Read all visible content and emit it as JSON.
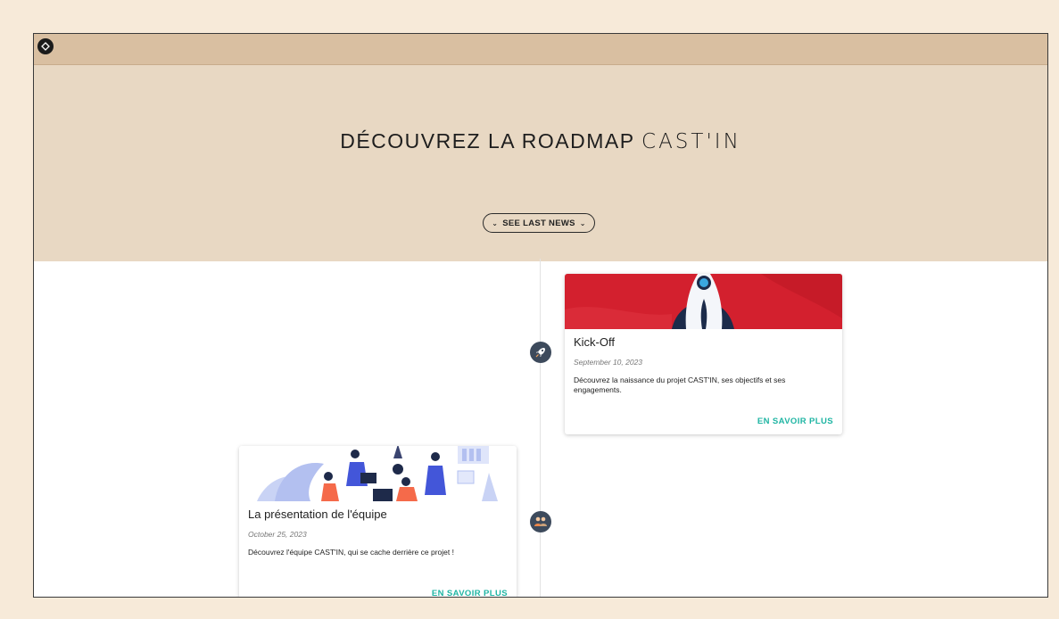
{
  "header": {
    "title_main": "DÉCOUVREZ LA ROADMAP",
    "title_brand": "CAST'IN",
    "news_button": "SEE LAST NEWS"
  },
  "timeline": [
    {
      "title": "Kick-Off",
      "date": "September 10, 2023",
      "description": "Découvrez la naissance du projet CAST'IN, ses objectifs et ses engagements.",
      "link": "EN SAVOIR PLUS",
      "icon": "rocket-icon"
    },
    {
      "title": "La présentation de l'équipe",
      "date": "October 25, 2023",
      "description": "Découvrez l'équipe CAST'IN, qui se cache derrière ce projet !",
      "link": "EN SAVOIR PLUS",
      "icon": "team-icon"
    }
  ],
  "colors": {
    "topbar": "#d9bfa1",
    "hero": "#e8d8c3",
    "accent": "#1fb5a3",
    "node": "#3d4a5c",
    "kickoff_banner": "#d3202e"
  }
}
